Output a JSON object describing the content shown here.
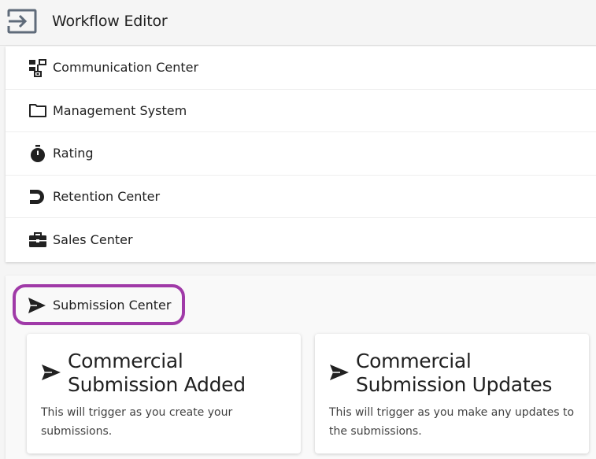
{
  "header": {
    "title": "Workflow Editor",
    "exit_icon": "exit-to-app-icon"
  },
  "categories": [
    {
      "label": "Communication Center",
      "icon": "sitemap-icon"
    },
    {
      "label": "Management System",
      "icon": "folder-icon"
    },
    {
      "label": "Rating",
      "icon": "stopwatch-icon"
    },
    {
      "label": "Retention Center",
      "icon": "magnet-icon"
    },
    {
      "label": "Sales Center",
      "icon": "briefcase-icon"
    }
  ],
  "submission": {
    "heading": "Submission Center",
    "icon": "send-icon",
    "highlight_color": "#a03aa8",
    "cards": [
      {
        "title": "Commercial Submission Added",
        "description": "This will trigger as you create your submissions."
      },
      {
        "title": "Commercial Submission Updates",
        "description": "This will trigger as you make any updates to the submissions."
      }
    ]
  }
}
